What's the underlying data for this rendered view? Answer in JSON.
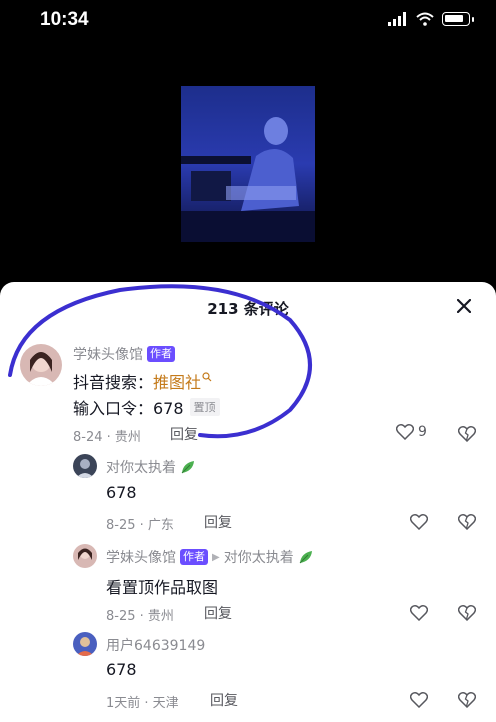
{
  "status": {
    "time": "10:34"
  },
  "sheet": {
    "title": "213 条评论"
  },
  "comments": [
    {
      "username": "学妹头像馆",
      "badge": "作者",
      "line1_prefix": "抖音搜索：",
      "line1_link": "推图社",
      "line2": "输入口令：678",
      "pin": "置顶",
      "meta": "8-24 · 贵州",
      "reply": "回复",
      "likes": "9"
    },
    {
      "username": "对你太执着",
      "text": "678",
      "meta": "8-25 · 广东",
      "reply": "回复"
    },
    {
      "username": "学妹头像馆",
      "badge": "作者",
      "reply_to": "对你太执着",
      "text": "看置顶作品取图",
      "meta": "8-25 · 贵州",
      "reply": "回复"
    },
    {
      "username": "用户64639149",
      "text": "678",
      "meta": "1天前 · 天津",
      "reply": "回复"
    }
  ]
}
